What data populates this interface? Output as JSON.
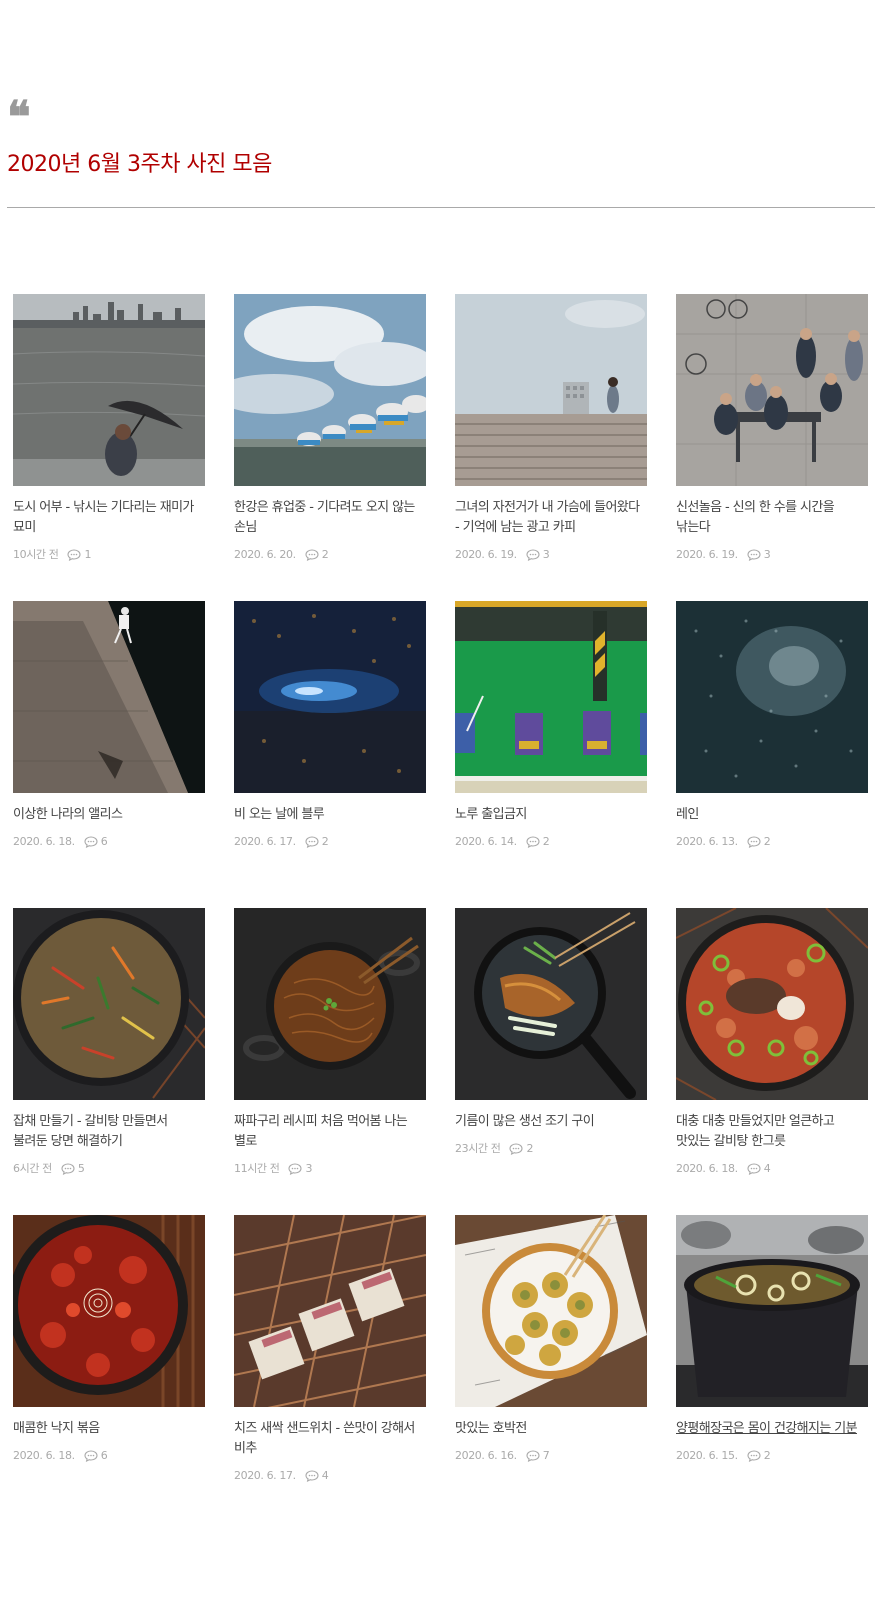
{
  "header": {
    "quote_mark": "❝",
    "title": "2020년 6월 3주차 사진 모음"
  },
  "posts": [
    {
      "title": "도시 어부 - 낚시는 기다리는 재미가 묘미",
      "date": "10시간 전",
      "comments": "1",
      "image": "river-fisherman-umbrella-photo"
    },
    {
      "title": "한강은 휴업중 - 기다려도 오지 않는 손님",
      "date": "2020. 6. 20.",
      "comments": "2",
      "image": "swan-boats-river-photo"
    },
    {
      "title": "그녀의 자전거가 내 가슴에 들어왔다 - 기억에 남는 광고 카피",
      "date": "2020. 6. 19.",
      "comments": "3",
      "image": "stairs-woman-sky-photo"
    },
    {
      "title": "신선놀음 - 신의 한 수를 시간을 낚는다",
      "date": "2020. 6. 19.",
      "comments": "3",
      "image": "men-playing-board-game-photo"
    },
    {
      "title": "이상한 나라의 앨리스",
      "date": "2020. 6. 18.",
      "comments": "6",
      "image": "diagonal-wall-shadow-photo"
    },
    {
      "title": "비 오는 날에 블루",
      "date": "2020. 6. 17.",
      "comments": "2",
      "image": "rainy-blue-night-photo"
    },
    {
      "title": "노루 출입금지",
      "date": "2020. 6. 14.",
      "comments": "2",
      "image": "green-parking-cans-photo"
    },
    {
      "title": "레인",
      "date": "2020. 6. 13.",
      "comments": "2",
      "image": "rain-drops-window-photo"
    },
    {
      "title": "잡채 만들기 - 갈비탕 만들면서 불려둔 당면 해결하기",
      "date": "6시간 전",
      "comments": "5",
      "image": "japchae-pan-photo"
    },
    {
      "title": "짜파구리 레시피 처음 먹어봄 나는 별로",
      "date": "11시간 전",
      "comments": "3",
      "image": "noodle-pot-photo"
    },
    {
      "title": "기름이 많은 생선 조기 구이",
      "date": "23시간 전",
      "comments": "2",
      "image": "grilled-fish-pan-photo"
    },
    {
      "title": "대충 대충 만들었지만 얼큰하고 맛있는 갈비탕 한그릇",
      "date": "2020. 6. 18.",
      "comments": "4",
      "image": "galbitang-pot-photo"
    },
    {
      "title": "매콤한 낙지 볶음",
      "date": "2020. 6. 18.",
      "comments": "6",
      "image": "spicy-octopus-pan-photo"
    },
    {
      "title": "치즈 새싹 샌드위치 - 쓴맛이 강해서 비추",
      "date": "2020. 6. 17.",
      "comments": "4",
      "image": "cheese-sandwich-rack-photo"
    },
    {
      "title": "맛있는 호박전",
      "date": "2020. 6. 16.",
      "comments": "7",
      "image": "zucchini-pancake-photo"
    },
    {
      "title": "양평해장국은 몸이 건강해지는 기분",
      "date": "2020. 6. 15.",
      "comments": "2",
      "image": "haejangguk-pot-photo"
    }
  ],
  "colors": {
    "title": "#b00000",
    "quote_mark": "#9a9a9a",
    "meta_text": "#aaaaaa",
    "card_title": "#444444",
    "divider": "#a9a9a9"
  }
}
